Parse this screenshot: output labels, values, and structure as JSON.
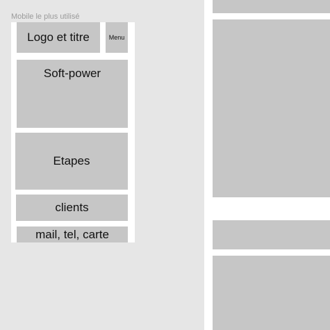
{
  "frame": {
    "label": "Mobile le plus utilisé"
  },
  "blocks": {
    "logo": "Logo et titre",
    "menu": "Menu",
    "softpower": "Soft-power",
    "etapes": "Etapes",
    "clients": "clients",
    "contact": "mail, tel, carte"
  }
}
